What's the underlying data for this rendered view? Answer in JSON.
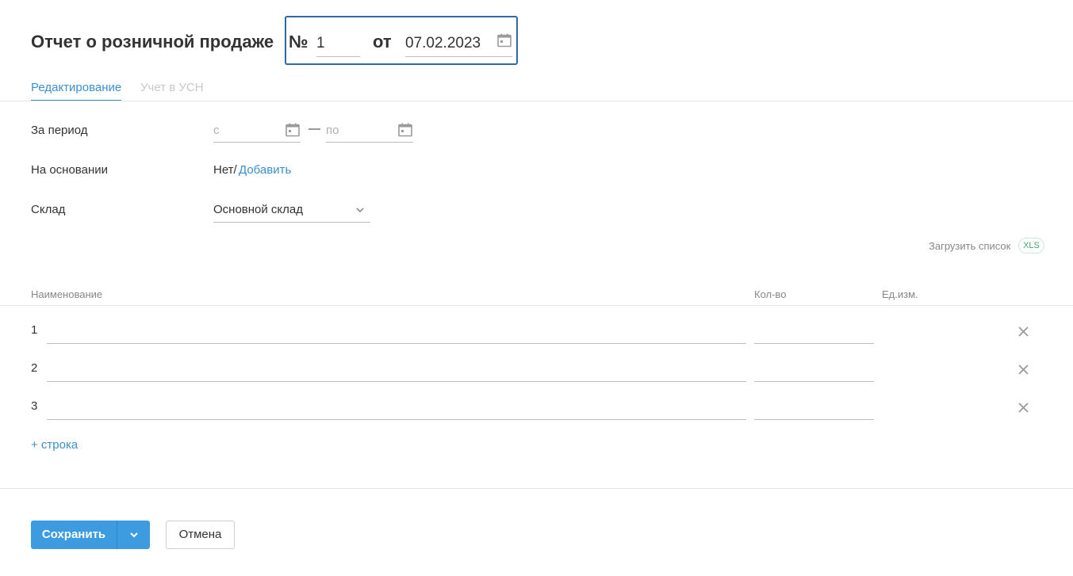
{
  "header": {
    "title": "Отчет о розничной продаже",
    "number_sign": "№",
    "number_value": "1",
    "from_label": "от",
    "date_value": "07.02.2023"
  },
  "tabs": [
    {
      "label": "Редактирование",
      "active": true
    },
    {
      "label": "Учет в УСН",
      "active": false
    }
  ],
  "form": {
    "period_label": "За период",
    "period_from_placeholder": "с",
    "period_dash": "—",
    "period_to_placeholder": "по",
    "basis_label": "На основании",
    "basis_none": "Нет/",
    "basis_add": "Добавить",
    "warehouse_label": "Склад",
    "warehouse_value": "Основной склад"
  },
  "upload": {
    "label": "Загрузить список",
    "badge": "XLS"
  },
  "table": {
    "headers": [
      "Наименование",
      "Кол-во",
      "Ед.изм."
    ],
    "rows": [
      "1",
      "2",
      "3"
    ],
    "add_row_label": "+ строка"
  },
  "footer": {
    "save_label": "Сохранить",
    "cancel_label": "Отмена"
  },
  "colors": {
    "accent": "#3d8fcf",
    "primary_button": "#3d9be0",
    "focus_border": "#2f6aa6",
    "xls_green": "#3aaa6a"
  },
  "icons": {
    "calendar": "calendar-icon",
    "chevron": "chevron-down-icon",
    "delete": "close-icon"
  }
}
